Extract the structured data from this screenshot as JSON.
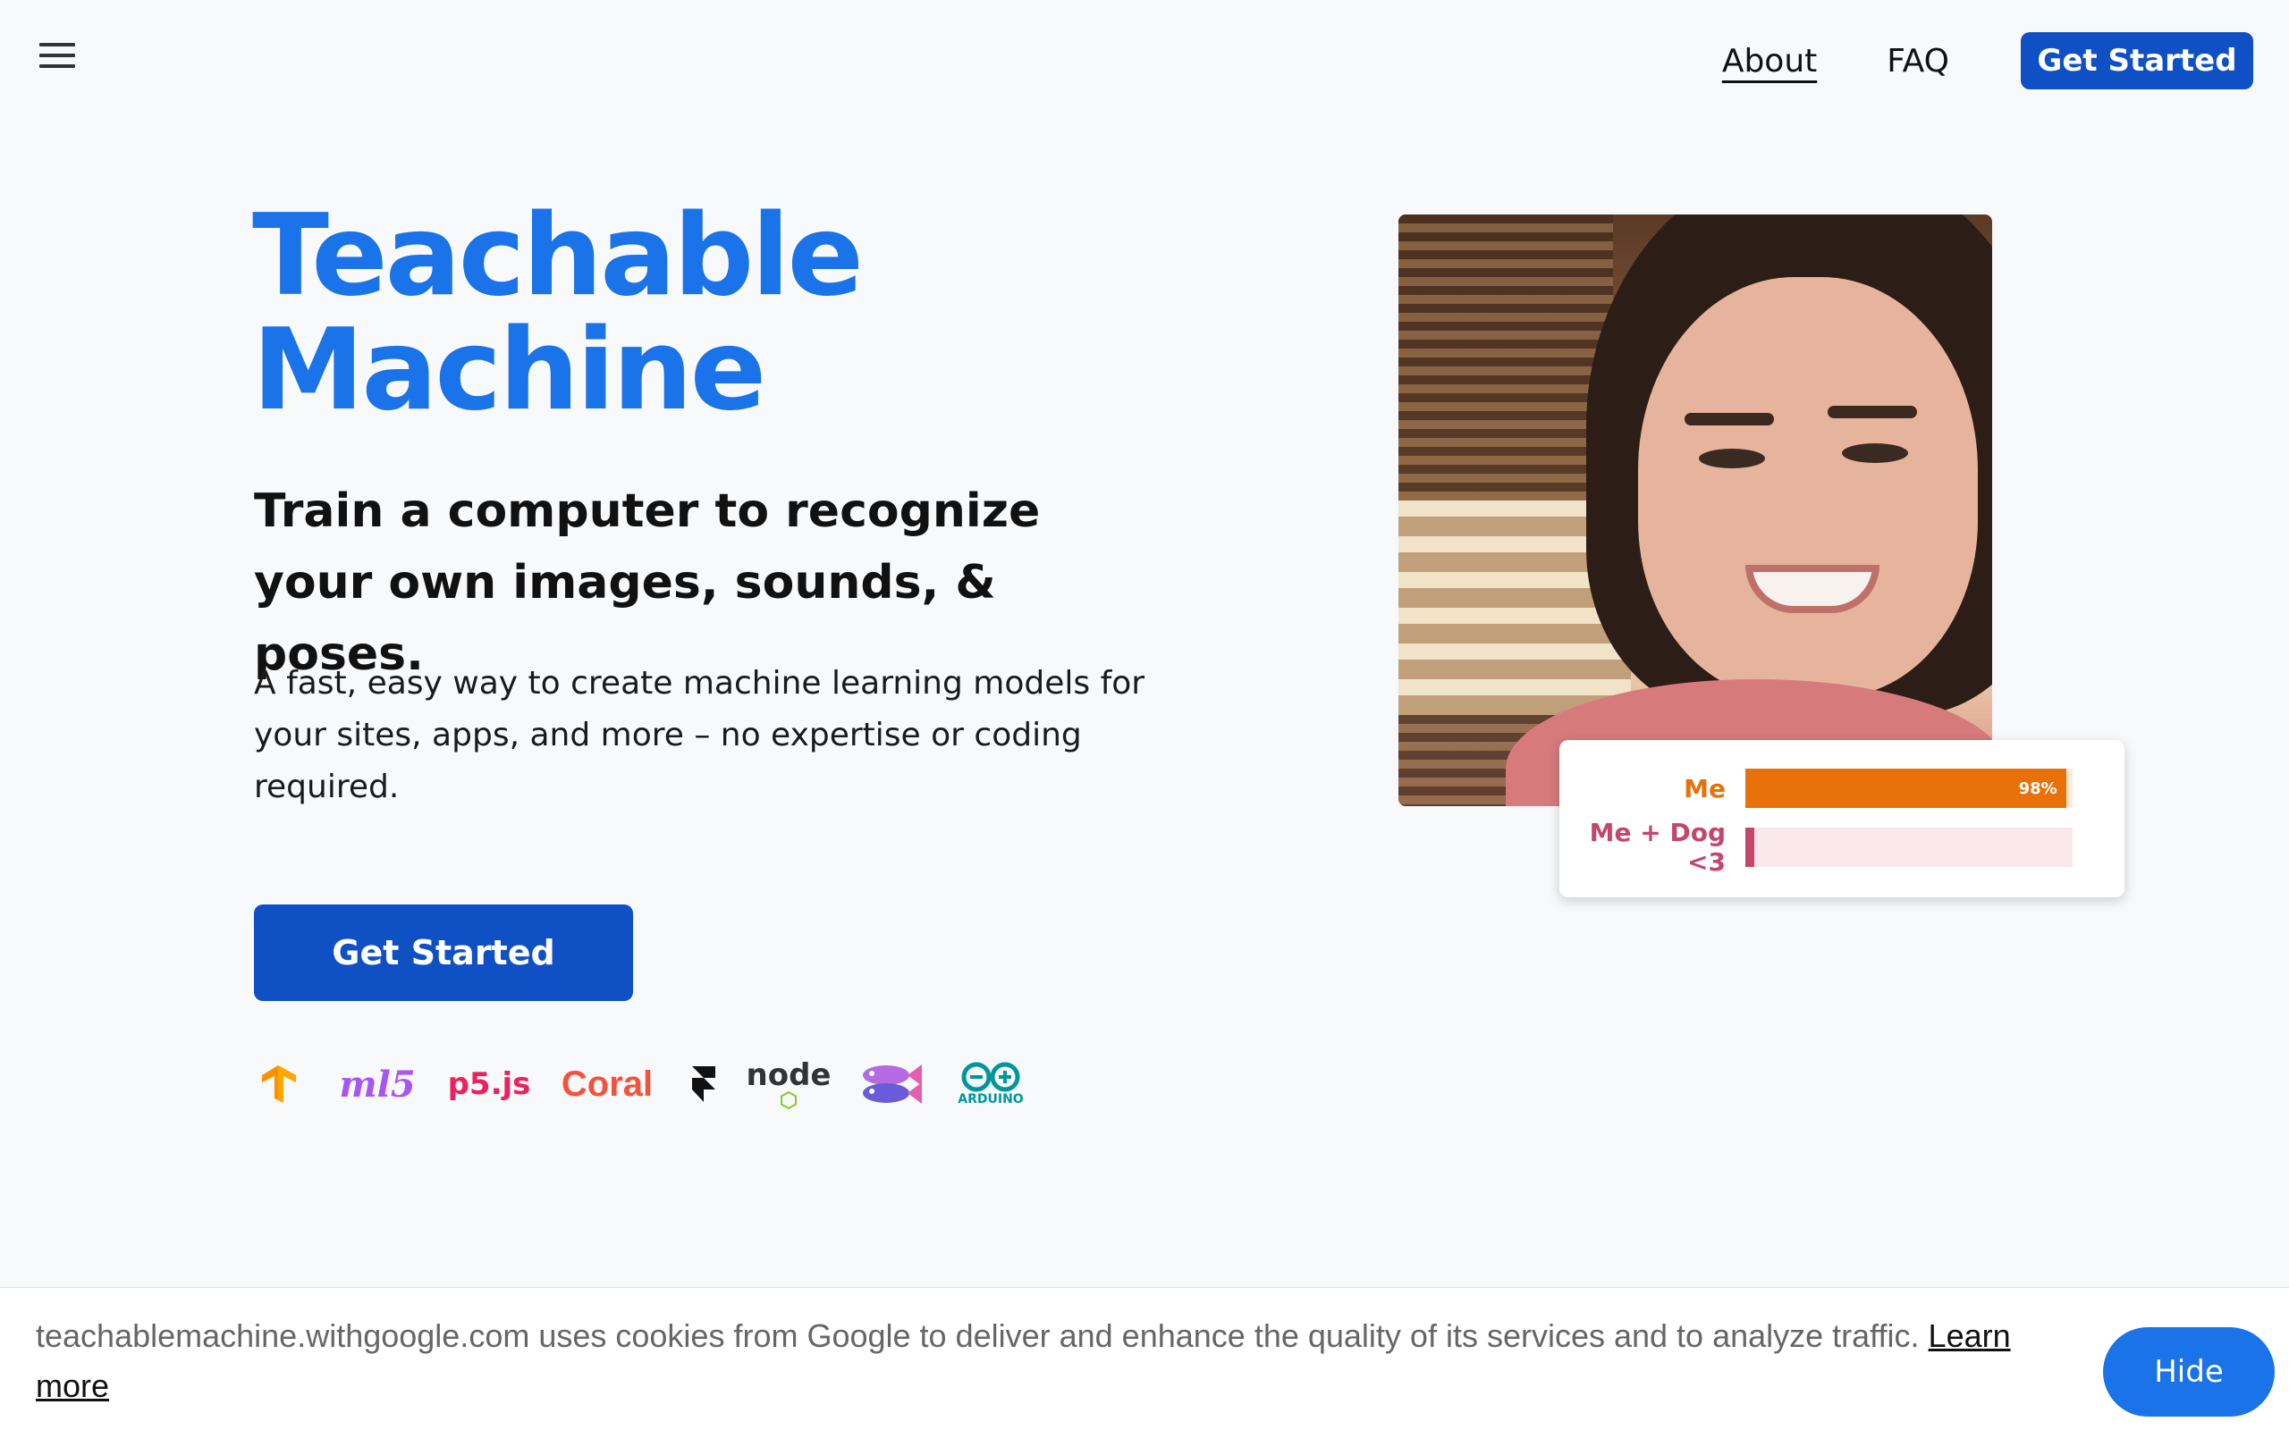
{
  "header": {
    "menu_icon": "hamburger-menu-icon",
    "nav_about": "About",
    "nav_faq": "FAQ",
    "nav_cta": "Get Started"
  },
  "hero": {
    "title_line1": "Teachable",
    "title_line2": "Machine",
    "subtitle": "Train a computer to recognize your own images, sounds, & poses.",
    "description": "A fast, easy way to create machine learning models for your sites, apps, and more – no expertise or coding required.",
    "cta": "Get Started"
  },
  "logos": [
    {
      "name": "tensorflow-logo",
      "text": ""
    },
    {
      "name": "ml5-logo",
      "text": "ml5"
    },
    {
      "name": "p5js-logo",
      "text": "p5.js"
    },
    {
      "name": "coral-logo",
      "text": "Coral"
    },
    {
      "name": "framer-logo",
      "text": ""
    },
    {
      "name": "nodejs-logo",
      "text": "node"
    },
    {
      "name": "fish-logo",
      "text": ""
    },
    {
      "name": "arduino-logo",
      "text": "ARDUINO"
    }
  ],
  "prediction": {
    "rows": [
      {
        "label": "Me",
        "value_text": "98%",
        "value": 0.98,
        "color": "#e8710a",
        "track": "#e8710a"
      },
      {
        "label": "Me + Dog <3",
        "value_text": "",
        "value": 0.0,
        "color": "#c5466b",
        "track": "#fbe8ec"
      }
    ]
  },
  "cookie": {
    "text": "teachablemachine.withgoogle.com uses cookies from Google to deliver and enhance the quality of its services and to analyze traffic.",
    "learn_more": "Learn more",
    "hide": "Hide"
  },
  "colors": {
    "primary_blue": "#1a73e8",
    "button_blue": "#0f50c4",
    "orange": "#e8710a",
    "pink": "#c5466b"
  }
}
